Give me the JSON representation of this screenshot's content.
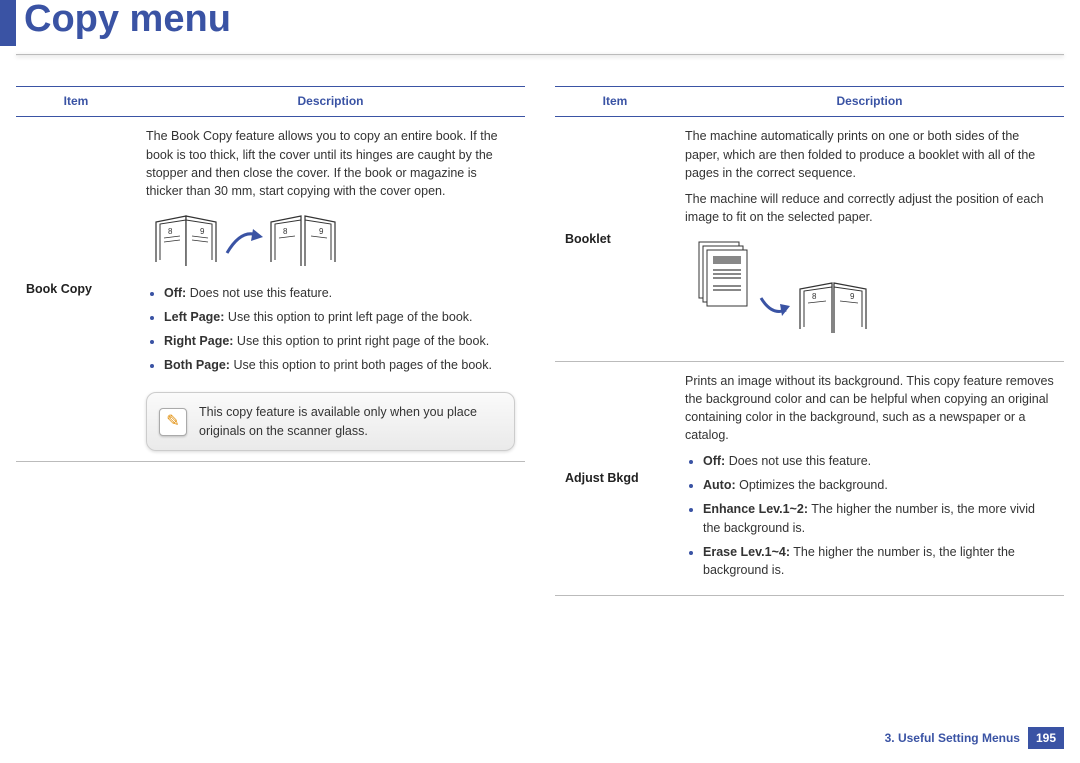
{
  "title": "Copy menu",
  "columns": {
    "item": "Item",
    "description": "Description"
  },
  "left": {
    "item": "Book Copy",
    "intro": "The Book Copy feature allows you to copy an entire book. If the book is too thick, lift the cover until its hinges are caught by the stopper and then close the cover. If the book or magazine is thicker than 30 mm, start copying with the cover open.",
    "options": [
      {
        "label": "Off:",
        "text": " Does not use this feature."
      },
      {
        "label": "Left Page:",
        "text": " Use this option to print left page of the book."
      },
      {
        "label": "Right Page:",
        "text": " Use this option to print right page of the book."
      },
      {
        "label": "Both Page:",
        "text": " Use this option to print both pages of the book."
      }
    ],
    "note": "This copy feature is available only when you place originals on the scanner glass."
  },
  "right_booklet": {
    "item": "Booklet",
    "p1": "The machine automatically prints on one or both sides of the paper, which are then folded to produce a booklet with all of the pages in the correct sequence.",
    "p2": "The machine will reduce and correctly adjust the position of each image to fit on the selected paper."
  },
  "right_adjust": {
    "item": "Adjust Bkgd",
    "intro": "Prints an image without its background. This copy feature removes the background color and can be helpful when copying an original containing color in the background, such as a newspaper or a catalog.",
    "options": [
      {
        "label": "Off:",
        "text": " Does not use this feature."
      },
      {
        "label": "Auto:",
        "text": " Optimizes the background."
      },
      {
        "label": "Enhance Lev.1~2:",
        "text": " The higher the number is, the more vivid the background is."
      },
      {
        "label": "Erase Lev.1~4:",
        "text": " The higher the number is, the lighter the background is."
      }
    ]
  },
  "footer": {
    "section": "3.  Useful Setting Menus",
    "page": "195"
  }
}
